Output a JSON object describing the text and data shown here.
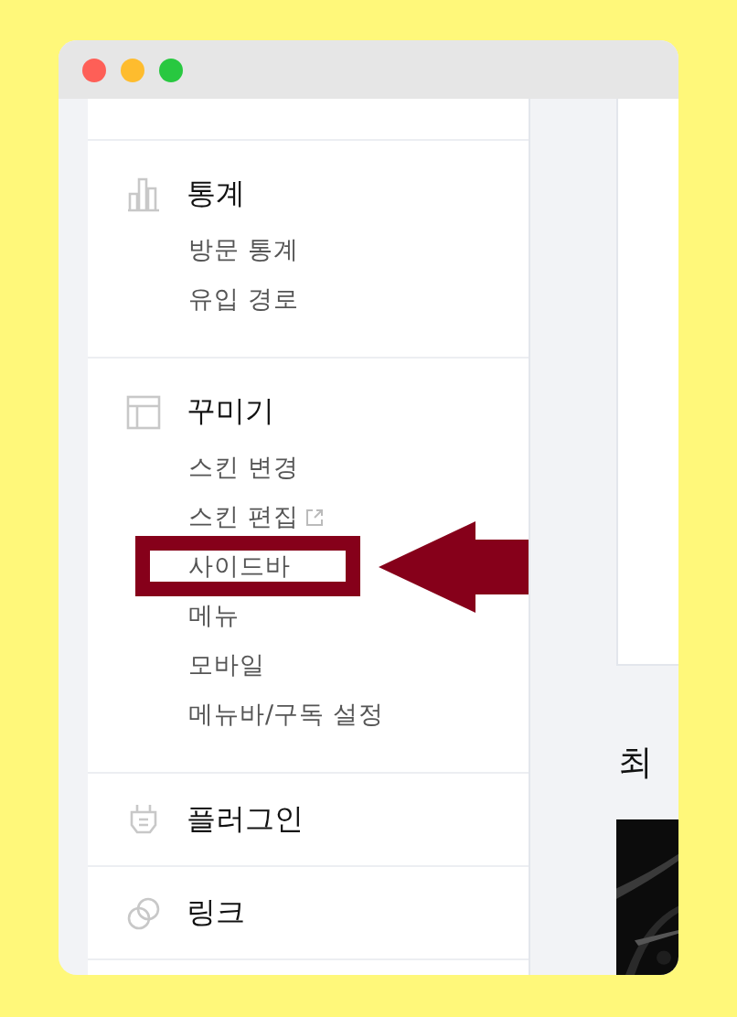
{
  "sidebar": {
    "sections": [
      {
        "title": "통계",
        "items": [
          {
            "label": "방문 통계",
            "external": false,
            "highlighted": false
          },
          {
            "label": "유입 경로",
            "external": false,
            "highlighted": false
          }
        ]
      },
      {
        "title": "꾸미기",
        "items": [
          {
            "label": "스킨 변경",
            "external": false,
            "highlighted": false
          },
          {
            "label": "스킨 편집",
            "external": true,
            "highlighted": false
          },
          {
            "label": "사이드바",
            "external": false,
            "highlighted": true
          },
          {
            "label": "메뉴",
            "external": false,
            "highlighted": false
          },
          {
            "label": "모바일",
            "external": false,
            "highlighted": false
          },
          {
            "label": "메뉴바/구독 설정",
            "external": false,
            "highlighted": false
          }
        ]
      },
      {
        "title": "플러그인"
      },
      {
        "title": "링크"
      }
    ]
  },
  "main": {
    "heading": "최"
  }
}
